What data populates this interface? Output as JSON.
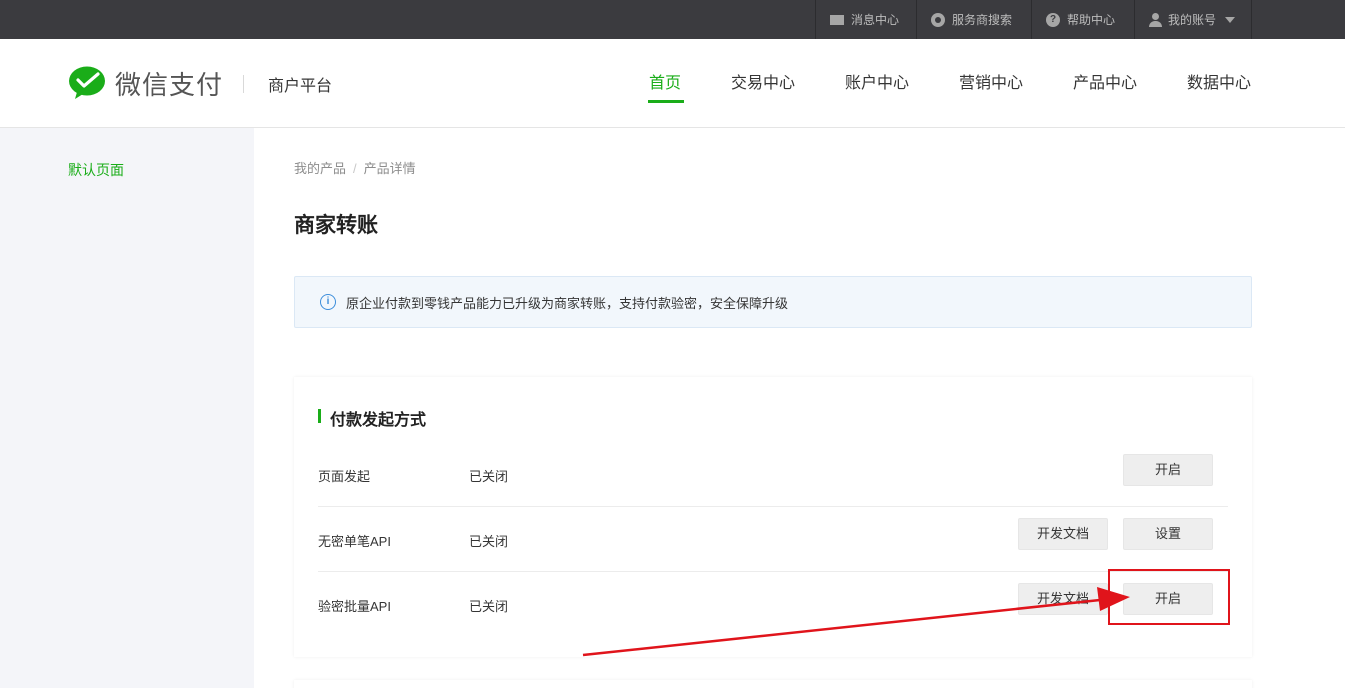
{
  "topbar": {
    "items": [
      {
        "label": "消息中心",
        "icon": "mail-icon"
      },
      {
        "label": "服务商搜索",
        "icon": "search-icon"
      },
      {
        "label": "帮助中心",
        "icon": "help-icon"
      },
      {
        "label": "我的账号",
        "icon": "user-icon"
      }
    ]
  },
  "header": {
    "logo_text": "微信支付",
    "platform": "商户平台",
    "nav": [
      {
        "label": "首页",
        "active": true
      },
      {
        "label": "交易中心"
      },
      {
        "label": "账户中心"
      },
      {
        "label": "营销中心"
      },
      {
        "label": "产品中心"
      },
      {
        "label": "数据中心"
      }
    ]
  },
  "sidebar": {
    "items": [
      {
        "label": "默认页面",
        "active": true
      }
    ]
  },
  "breadcrumb": {
    "items": [
      "我的产品",
      "产品详情"
    ],
    "separator": "/"
  },
  "page_title": "商家转账",
  "notice": {
    "text": "原企业付款到零钱产品能力已升级为商家转账，支持付款验密，安全保障升级",
    "icon": "info-icon"
  },
  "section": {
    "title": "付款发起方式",
    "rows": [
      {
        "name": "页面发起",
        "status": "已关闭",
        "buttons": [
          "开启"
        ]
      },
      {
        "name": "无密单笔API",
        "status": "已关闭",
        "buttons": [
          "开发文档",
          "设置"
        ]
      },
      {
        "name": "验密批量API",
        "status": "已关闭",
        "buttons": [
          "开发文档",
          "开启"
        ]
      }
    ]
  },
  "colors": {
    "brand_green": "#1aad19",
    "topbar_bg": "#3b3b3f",
    "annotation_red": "#e0141b"
  }
}
